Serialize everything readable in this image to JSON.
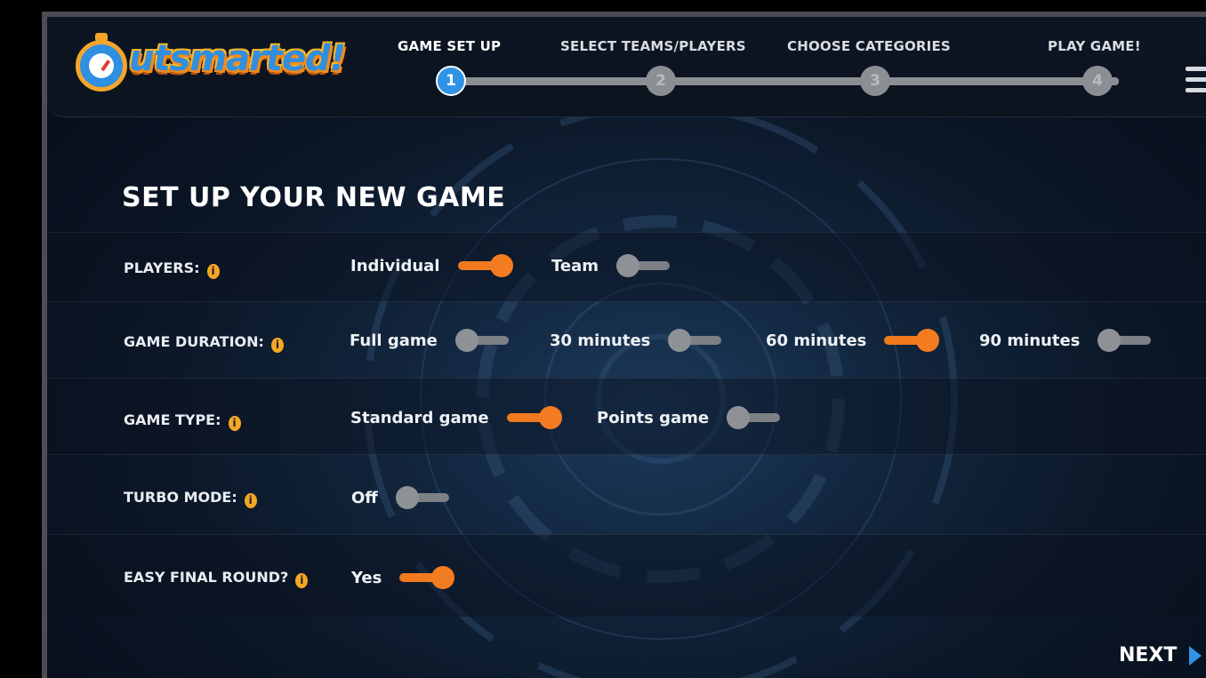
{
  "app": {
    "logo_text": "utsmarted!"
  },
  "steps": [
    {
      "label": "GAME SET UP",
      "number": "1",
      "active": true
    },
    {
      "label": "SELECT TEAMS/PLAYERS",
      "number": "2",
      "active": false
    },
    {
      "label": "CHOOSE CATEGORIES",
      "number": "3",
      "active": false
    },
    {
      "label": "PLAY GAME!",
      "number": "4",
      "active": false
    }
  ],
  "page": {
    "title": "SET UP YOUR NEW GAME",
    "next_label": "NEXT"
  },
  "settings": {
    "players": {
      "label": "PLAYERS:",
      "options": [
        {
          "label": "Individual",
          "on": true
        },
        {
          "label": "Team",
          "on": false
        }
      ]
    },
    "duration": {
      "label": "GAME DURATION:",
      "options": [
        {
          "label": "Full game",
          "on": false
        },
        {
          "label": "30 minutes",
          "on": false
        },
        {
          "label": "60 minutes",
          "on": true
        },
        {
          "label": "90 minutes",
          "on": false
        }
      ]
    },
    "game_type": {
      "label": "GAME TYPE:",
      "options": [
        {
          "label": "Standard game",
          "on": true
        },
        {
          "label": "Points game",
          "on": false
        }
      ]
    },
    "turbo": {
      "label": "TURBO MODE:",
      "options": [
        {
          "label": "Off",
          "on": false
        }
      ]
    },
    "easy_final": {
      "label": "EASY FINAL ROUND?",
      "options": [
        {
          "label": "Yes",
          "on": true
        }
      ]
    }
  },
  "colors": {
    "accent_orange": "#f47c20",
    "accent_blue": "#2f93e6",
    "info_yellow": "#f5a623"
  },
  "icons": {
    "info": "info-icon",
    "menu": "hamburger-menu-icon",
    "next": "play-arrow-icon"
  }
}
